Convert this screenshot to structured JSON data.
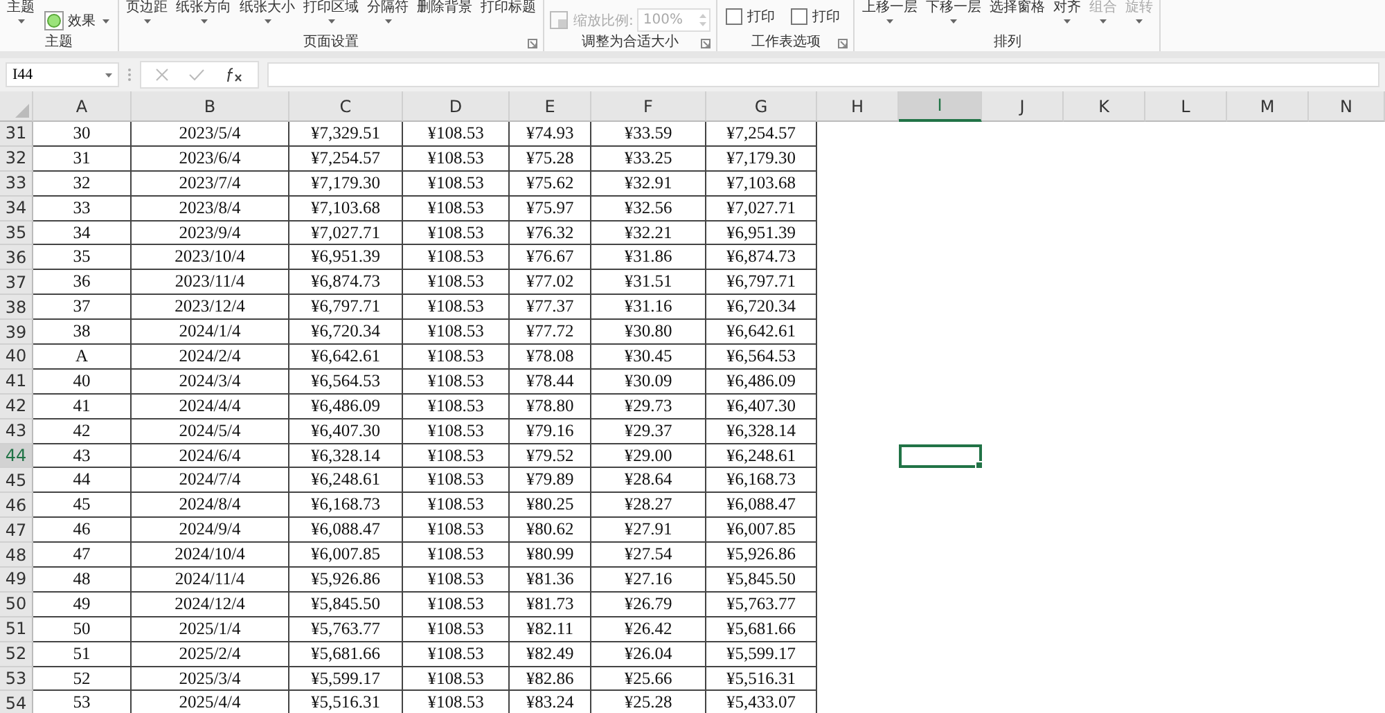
{
  "ribbon": {
    "groups": [
      {
        "label": "主题",
        "launcher": false,
        "items": [
          {
            "kind": "button",
            "label": "主题",
            "dropdown": true,
            "disabled": false
          },
          {
            "kind": "effect",
            "label": "效果",
            "dropdown": true,
            "disabled": false
          }
        ]
      },
      {
        "label": "页面设置",
        "launcher": true,
        "items": [
          {
            "kind": "button",
            "label": "页边距",
            "dropdown": true,
            "disabled": false
          },
          {
            "kind": "button",
            "label": "纸张方向",
            "dropdown": true,
            "disabled": false
          },
          {
            "kind": "button",
            "label": "纸张大小",
            "dropdown": true,
            "disabled": false
          },
          {
            "kind": "button",
            "label": "打印区域",
            "dropdown": true,
            "disabled": false
          },
          {
            "kind": "button",
            "label": "分隔符",
            "dropdown": true,
            "disabled": false
          },
          {
            "kind": "button",
            "label": "删除背景",
            "dropdown": false,
            "disabled": false
          },
          {
            "kind": "button",
            "label": "打印标题",
            "dropdown": false,
            "disabled": false
          }
        ]
      },
      {
        "label": "调整为合适大小",
        "launcher": true,
        "items": [
          {
            "kind": "scale",
            "label": "缩放比例:",
            "value": "100%",
            "disabled": true
          }
        ]
      },
      {
        "label": "工作表选项",
        "launcher": true,
        "items": [
          {
            "kind": "checkbox",
            "label": "打印",
            "checked": false,
            "disabled": false
          },
          {
            "kind": "checkbox",
            "label": "打印",
            "checked": false,
            "disabled": false
          }
        ]
      },
      {
        "label": "排列",
        "launcher": false,
        "items": [
          {
            "kind": "button",
            "label": "上移一层",
            "dropdown": true,
            "disabled": false
          },
          {
            "kind": "button",
            "label": "下移一层",
            "dropdown": true,
            "disabled": false
          },
          {
            "kind": "button",
            "label": "选择窗格",
            "dropdown": false,
            "disabled": false
          },
          {
            "kind": "button",
            "label": "对齐",
            "dropdown": true,
            "disabled": false
          },
          {
            "kind": "button",
            "label": "组合",
            "dropdown": true,
            "disabled": true
          },
          {
            "kind": "button",
            "label": "旋转",
            "dropdown": true,
            "disabled": true
          }
        ]
      }
    ]
  },
  "formula_bar": {
    "name_box": "I44"
  },
  "sheet": {
    "columns": [
      {
        "label": "A",
        "selected": false
      },
      {
        "label": "B",
        "selected": false
      },
      {
        "label": "C",
        "selected": false
      },
      {
        "label": "D",
        "selected": false
      },
      {
        "label": "E",
        "selected": false
      },
      {
        "label": "F",
        "selected": false
      },
      {
        "label": "G",
        "selected": false
      },
      {
        "label": "H",
        "selected": false
      },
      {
        "label": "I",
        "selected": true
      },
      {
        "label": "J",
        "selected": false
      },
      {
        "label": "K",
        "selected": false
      },
      {
        "label": "L",
        "selected": false
      },
      {
        "label": "M",
        "selected": false
      },
      {
        "label": "N",
        "selected": false
      }
    ],
    "rows": [
      {
        "number": "31",
        "selected": false,
        "cells": [
          "30",
          "2023/5/4",
          "¥7,329.51",
          "¥108.53",
          "¥74.93",
          "¥33.59",
          "¥7,254.57"
        ]
      },
      {
        "number": "32",
        "selected": false,
        "cells": [
          "31",
          "2023/6/4",
          "¥7,254.57",
          "¥108.53",
          "¥75.28",
          "¥33.25",
          "¥7,179.30"
        ]
      },
      {
        "number": "33",
        "selected": false,
        "cells": [
          "32",
          "2023/7/4",
          "¥7,179.30",
          "¥108.53",
          "¥75.62",
          "¥32.91",
          "¥7,103.68"
        ]
      },
      {
        "number": "34",
        "selected": false,
        "cells": [
          "33",
          "2023/8/4",
          "¥7,103.68",
          "¥108.53",
          "¥75.97",
          "¥32.56",
          "¥7,027.71"
        ]
      },
      {
        "number": "35",
        "selected": false,
        "cells": [
          "34",
          "2023/9/4",
          "¥7,027.71",
          "¥108.53",
          "¥76.32",
          "¥32.21",
          "¥6,951.39"
        ]
      },
      {
        "number": "36",
        "selected": false,
        "cells": [
          "35",
          "2023/10/4",
          "¥6,951.39",
          "¥108.53",
          "¥76.67",
          "¥31.86",
          "¥6,874.73"
        ]
      },
      {
        "number": "37",
        "selected": false,
        "cells": [
          "36",
          "2023/11/4",
          "¥6,874.73",
          "¥108.53",
          "¥77.02",
          "¥31.51",
          "¥6,797.71"
        ]
      },
      {
        "number": "38",
        "selected": false,
        "cells": [
          "37",
          "2023/12/4",
          "¥6,797.71",
          "¥108.53",
          "¥77.37",
          "¥31.16",
          "¥6,720.34"
        ]
      },
      {
        "number": "39",
        "selected": false,
        "cells": [
          "38",
          "2024/1/4",
          "¥6,720.34",
          "¥108.53",
          "¥77.72",
          "¥30.80",
          "¥6,642.61"
        ]
      },
      {
        "number": "40",
        "selected": false,
        "cells": [
          "A",
          "2024/2/4",
          "¥6,642.61",
          "¥108.53",
          "¥78.08",
          "¥30.45",
          "¥6,564.53"
        ]
      },
      {
        "number": "41",
        "selected": false,
        "cells": [
          "40",
          "2024/3/4",
          "¥6,564.53",
          "¥108.53",
          "¥78.44",
          "¥30.09",
          "¥6,486.09"
        ]
      },
      {
        "number": "42",
        "selected": false,
        "cells": [
          "41",
          "2024/4/4",
          "¥6,486.09",
          "¥108.53",
          "¥78.80",
          "¥29.73",
          "¥6,407.30"
        ]
      },
      {
        "number": "43",
        "selected": false,
        "cells": [
          "42",
          "2024/5/4",
          "¥6,407.30",
          "¥108.53",
          "¥79.16",
          "¥29.37",
          "¥6,328.14"
        ]
      },
      {
        "number": "44",
        "selected": true,
        "cells": [
          "43",
          "2024/6/4",
          "¥6,328.14",
          "¥108.53",
          "¥79.52",
          "¥29.00",
          "¥6,248.61"
        ]
      },
      {
        "number": "45",
        "selected": false,
        "cells": [
          "44",
          "2024/7/4",
          "¥6,248.61",
          "¥108.53",
          "¥79.89",
          "¥28.64",
          "¥6,168.73"
        ]
      },
      {
        "number": "46",
        "selected": false,
        "cells": [
          "45",
          "2024/8/4",
          "¥6,168.73",
          "¥108.53",
          "¥80.25",
          "¥28.27",
          "¥6,088.47"
        ]
      },
      {
        "number": "47",
        "selected": false,
        "cells": [
          "46",
          "2024/9/4",
          "¥6,088.47",
          "¥108.53",
          "¥80.62",
          "¥27.91",
          "¥6,007.85"
        ]
      },
      {
        "number": "48",
        "selected": false,
        "cells": [
          "47",
          "2024/10/4",
          "¥6,007.85",
          "¥108.53",
          "¥80.99",
          "¥27.54",
          "¥5,926.86"
        ]
      },
      {
        "number": "49",
        "selected": false,
        "cells": [
          "48",
          "2024/11/4",
          "¥5,926.86",
          "¥108.53",
          "¥81.36",
          "¥27.16",
          "¥5,845.50"
        ]
      },
      {
        "number": "50",
        "selected": false,
        "cells": [
          "49",
          "2024/12/4",
          "¥5,845.50",
          "¥108.53",
          "¥81.73",
          "¥26.79",
          "¥5,763.77"
        ]
      },
      {
        "number": "51",
        "selected": false,
        "cells": [
          "50",
          "2025/1/4",
          "¥5,763.77",
          "¥108.53",
          "¥82.11",
          "¥26.42",
          "¥5,681.66"
        ]
      },
      {
        "number": "52",
        "selected": false,
        "cells": [
          "51",
          "2025/2/4",
          "¥5,681.66",
          "¥108.53",
          "¥82.49",
          "¥26.04",
          "¥5,599.17"
        ]
      },
      {
        "number": "53",
        "selected": false,
        "cells": [
          "52",
          "2025/3/4",
          "¥5,599.17",
          "¥108.53",
          "¥82.86",
          "¥25.66",
          "¥5,516.31"
        ]
      },
      {
        "number": "54",
        "selected": false,
        "cells": [
          "53",
          "2025/4/4",
          "¥5,516.31",
          "¥108.53",
          "¥83.24",
          "¥25.28",
          "¥5,433.07"
        ]
      }
    ]
  }
}
